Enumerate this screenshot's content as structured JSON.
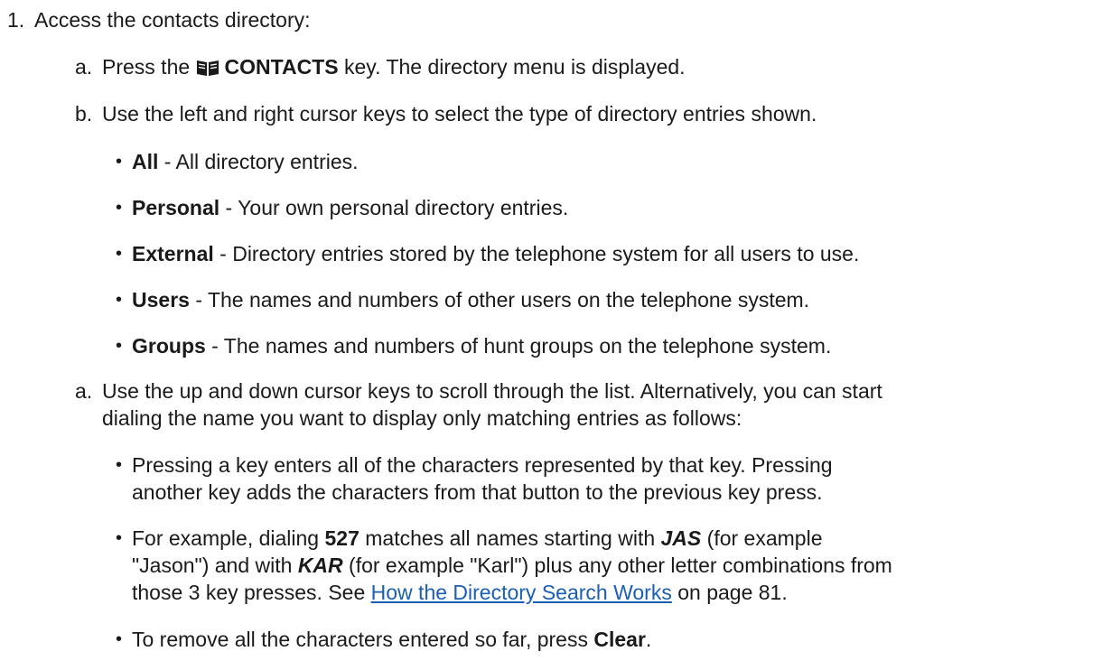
{
  "steps": [
    {
      "number": "1.",
      "text": "Access the contacts directory:",
      "substeps": [
        {
          "marker": "a.",
          "pre": "Press the",
          "key_label": "CONTACTS",
          "post": "key. The directory menu is displayed."
        },
        {
          "marker": "b.",
          "text": "Use the left and right cursor keys to select the type of directory entries shown.",
          "bullets": [
            {
              "term": "All",
              "desc": " - All directory entries."
            },
            {
              "term": "Personal",
              "desc": " - Your own personal directory entries."
            },
            {
              "term": "External",
              "desc": " - Directory entries stored by the telephone system for all users to use."
            },
            {
              "term": "Users",
              "desc": " - The names and numbers of other users on the telephone system."
            },
            {
              "term": "Groups",
              "desc": " - The names and numbers of hunt groups on the telephone system."
            }
          ]
        },
        {
          "marker": "a.",
          "line1": "Use the up and down cursor keys to scroll through the list. Alternatively, you can start",
          "line2": "dialing the name you want to display only matching entries as follows:",
          "bullets": [
            {
              "line1": "Pressing a key enters all of the characters represented by that key. Pressing",
              "line2": "another key adds the characters from that button to the previous key press."
            },
            {
              "l1_a": "For example, dialing ",
              "l1_b": "527",
              "l1_c": " matches all names starting with ",
              "l1_d": "JAS",
              "l1_e": " (for example",
              "l2_a": "\"Jason\") and with ",
              "l2_b": "KAR",
              "l2_c": " (for example \"Karl\") plus any other letter combinations from",
              "l3_a": "those 3 key presses. See ",
              "l3_link": "How the Directory Search Works",
              "l3_c": " on page 81."
            },
            {
              "pre": "To remove all the characters entered so far, press ",
              "term": "Clear",
              "post": "."
            }
          ]
        }
      ]
    }
  ],
  "bullet_glyph": "•",
  "link_color": "#1a5fb4",
  "icons": [
    "book-icon"
  ]
}
